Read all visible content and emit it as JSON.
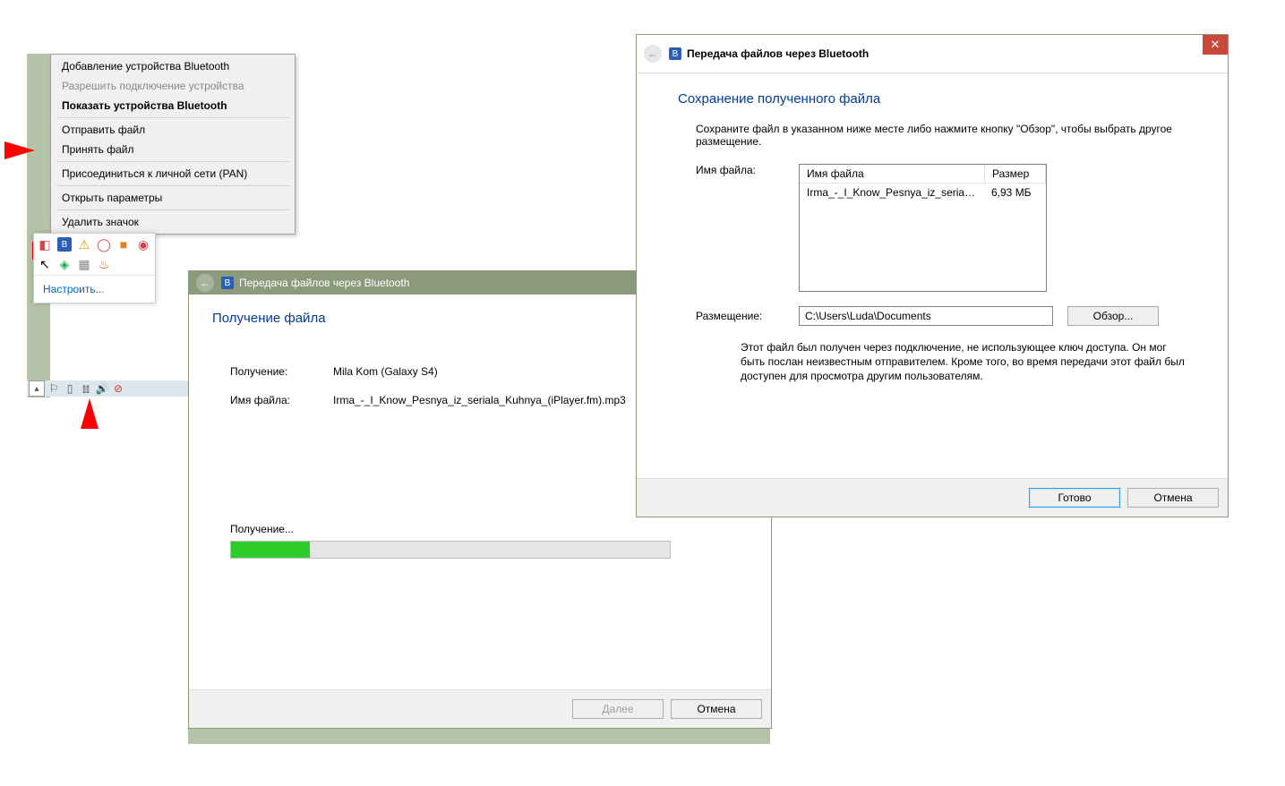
{
  "context_menu": {
    "items": [
      {
        "label": "Добавление устройства Bluetooth",
        "bold": false,
        "disabled": false
      },
      {
        "label": "Разрешить подключение устройства",
        "bold": false,
        "disabled": true
      },
      {
        "label": "Показать устройства Bluetooth",
        "bold": true,
        "disabled": false
      },
      {
        "label": "Отправить файл",
        "bold": false,
        "disabled": false
      },
      {
        "label": "Принять файл",
        "bold": false,
        "disabled": false
      },
      {
        "label": "Присоединиться к личной сети (PAN)",
        "bold": false,
        "disabled": false
      },
      {
        "label": "Открыть параметры",
        "bold": false,
        "disabled": false
      },
      {
        "label": "Удалить значок",
        "bold": false,
        "disabled": false
      }
    ]
  },
  "tray": {
    "customize": "Настроить..."
  },
  "receive_window": {
    "title": "Передача файлов через Bluetooth",
    "heading": "Получение файла",
    "receive_label": "Получение:",
    "receive_value": "Mila Kom (Galaxy S4)",
    "filename_label": "Имя файла:",
    "filename_value": "Irma_-_I_Know_Pesnya_iz_seriala_Kuhnya_(iPlayer.fm).mp3",
    "progress_label": "Получение...",
    "next": "Далее",
    "cancel": "Отмена"
  },
  "save_window": {
    "title": "Передача файлов через Bluetooth",
    "heading": "Сохранение полученного файла",
    "instruction": "Сохраните файл в указанном ниже месте либо нажмите кнопку \"Обзор\", чтобы выбрать другое размещение.",
    "filename_label": "Имя файла:",
    "table": {
      "col_name": "Имя файла",
      "col_size": "Размер",
      "row_name": "Irma_-_I_Know_Pesnya_iz_seriala_K...",
      "row_size": "6,93 МБ"
    },
    "location_label": "Размещение:",
    "location_value": "C:\\Users\\Luda\\Documents",
    "browse": "Обзор...",
    "warning": "Этот файл был получен через подключение, не использующее ключ доступа. Он мог быть послан неизвестным отправителем.  Кроме того, во время передачи этот файл был доступен для просмотра другим пользователям.",
    "done": "Готово",
    "cancel": "Отмена"
  }
}
